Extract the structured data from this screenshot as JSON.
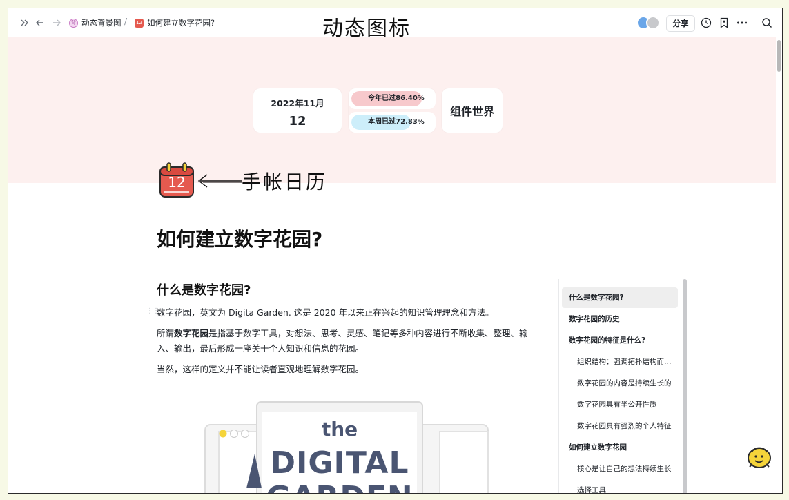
{
  "topbar": {
    "breadcrumb_1": "动态背景图",
    "breadcrumb_1_icon": "purple-page-icon",
    "breadcrumb_1_icon_text": "背",
    "breadcrumb_2": "如何建立数字花园?",
    "breadcrumb_2_icon": "calendar-icon",
    "breadcrumb_2_icon_text": "12",
    "separator": "/",
    "center_title": "动态图标",
    "share_label": "分享"
  },
  "cover": {
    "date_ym": "2022年11月",
    "date_day": "12",
    "progress": [
      {
        "label": "今年已过86.40%",
        "value": 0.864,
        "color": "#f7c9cc"
      },
      {
        "label": "本周已过72.83%",
        "value": 0.7283,
        "color": "#cdeefa"
      }
    ],
    "world_label": "组件世界",
    "background_color": "#fdf0ef"
  },
  "annotation": {
    "text": "手帐日历",
    "calendar_day": "12"
  },
  "document": {
    "title": "如何建立数字花园?",
    "h2": "什么是数字花园?",
    "para1": "数字花园，英文为 Digita Garden. 这是 2020 年以来正在兴起的知识管理理念和方法。",
    "para2_prefix": "所谓",
    "para2_bold": "数字花园",
    "para2_rest": "是指基于数字工具，对想法、思考、灵感、笔记等多种内容进行不断收集、整理、输入、输出，最后形成一座关于个人知识和信息的花园。",
    "para3": "当然，这样的定义并不能让读者直观地理解数字花园。",
    "hero_the": "the",
    "hero_line1": "DIGITAL",
    "hero_line2": "GARDEN"
  },
  "toc": [
    {
      "label": "什么是数字花园?",
      "level": 1,
      "active": true
    },
    {
      "label": "数字花园的历史",
      "level": 1,
      "active": false
    },
    {
      "label": "数字花园的特征是什么?",
      "level": 1,
      "active": false
    },
    {
      "label": "组织结构：强调拓扑结构而非时间顺序",
      "level": 2,
      "active": false
    },
    {
      "label": "数字花园的内容是持续生长的",
      "level": 2,
      "active": false
    },
    {
      "label": "数字花园具有半公开性质",
      "level": 2,
      "active": false
    },
    {
      "label": "数字花园具有强烈的个人特征",
      "level": 2,
      "active": false
    },
    {
      "label": "如何建立数字花园",
      "level": 1,
      "active": false
    },
    {
      "label": "核心是让自己的想法持续生长",
      "level": 2,
      "active": false
    },
    {
      "label": "选择工具",
      "level": 2,
      "active": false
    }
  ],
  "colors": {
    "calendar_red": "#e55a4f",
    "accent_yellow": "#f5d43a",
    "hero_text": "#4a5572"
  }
}
